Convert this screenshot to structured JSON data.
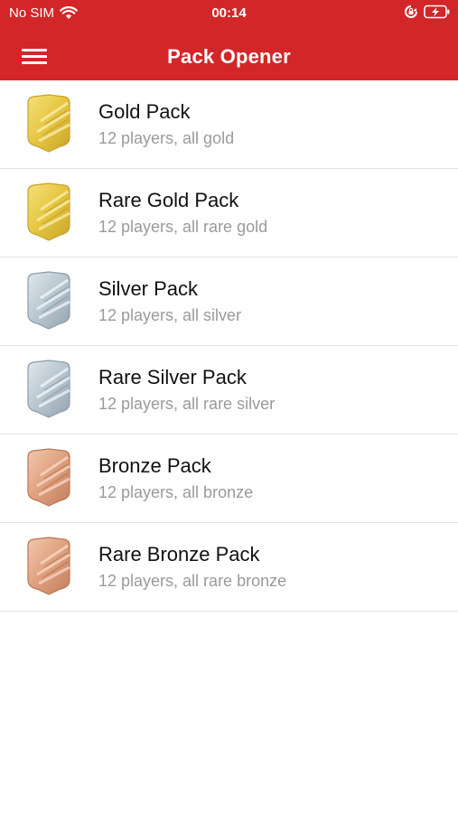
{
  "status_bar": {
    "carrier": "No SIM",
    "time": "00:14"
  },
  "navbar": {
    "title": "Pack Opener"
  },
  "packs": [
    {
      "title": "Gold Pack",
      "subtitle": "12 players, all gold",
      "icon": "gold-badge-icon"
    },
    {
      "title": "Rare Gold Pack",
      "subtitle": "12 players, all rare gold",
      "icon": "rare-gold-badge-icon"
    },
    {
      "title": "Silver Pack",
      "subtitle": "12 players, all silver",
      "icon": "silver-badge-icon"
    },
    {
      "title": "Rare Silver Pack",
      "subtitle": "12 players, all rare silver",
      "icon": "rare-silver-badge-icon"
    },
    {
      "title": "Bronze Pack",
      "subtitle": "12 players, all bronze",
      "icon": "bronze-badge-icon"
    },
    {
      "title": "Rare Bronze Pack",
      "subtitle": "12 players, all rare bronze",
      "icon": "rare-bronze-badge-icon"
    }
  ],
  "colors": {
    "header": "#d32628",
    "gold": "#e7c84a",
    "silver": "#b9c7d1",
    "bronze": "#e0a98a"
  }
}
